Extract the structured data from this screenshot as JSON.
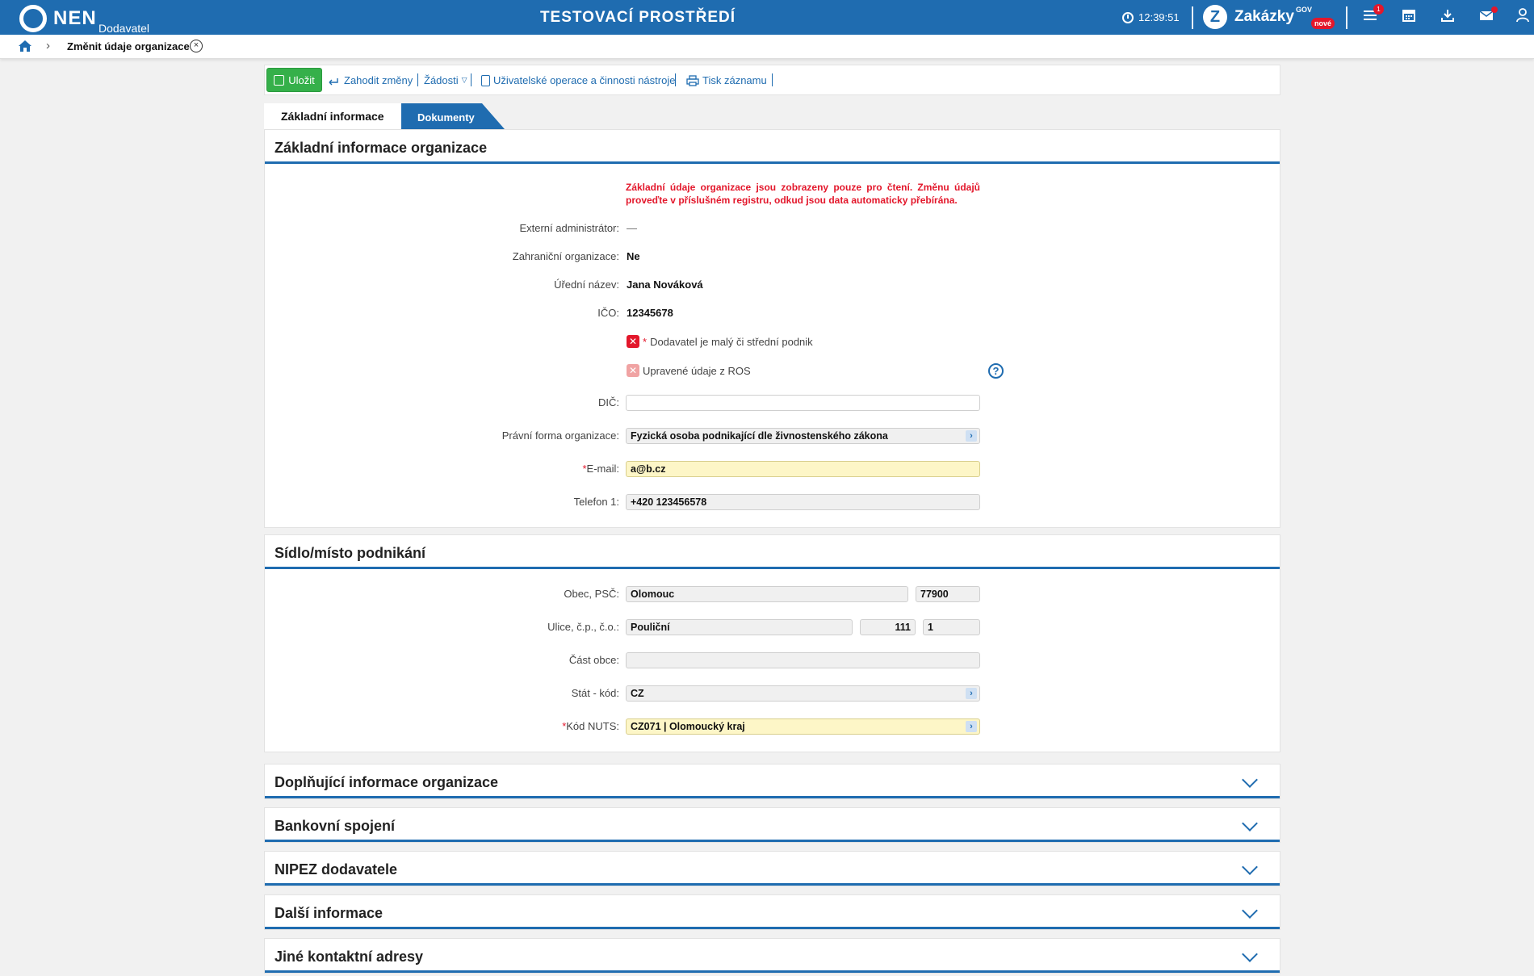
{
  "topbar": {
    "logo_text": "NEN",
    "logo_sub": "Dodavatel",
    "env_title": "TESTOVACÍ PROSTŘEDÍ",
    "time": "12:39:51",
    "zakazky": "Zakázky",
    "gov": "GOV",
    "new_badge": "nové",
    "menu_badge": "1",
    "icons": [
      "clock-icon",
      "menu-icon",
      "calendar-icon",
      "download-icon",
      "mail-icon",
      "user-icon"
    ]
  },
  "breadcrumb": {
    "label": "Změnit údaje organizace"
  },
  "toolbar": {
    "save": "Uložit",
    "discard": "Zahodit změny",
    "requests": "Žádosti",
    "user_ops": "Uživatelské operace a činnosti nástroje",
    "print": "Tisk záznamu"
  },
  "tabs": {
    "basic": "Základní informace",
    "documents": "Dokumenty"
  },
  "basic_panel": {
    "title": "Základní informace organizace",
    "notice": "Základní údaje organizace jsou zobrazeny pouze pro čtení. Změnu údajů proveďte v příslušném registru, odkud jsou data automaticky přebírána.",
    "ext_admin_label": "Externí administrátor:",
    "ext_admin_value": "—",
    "foreign_label": "Zahraniční organizace:",
    "foreign_value": "Ne",
    "official_name_label": "Úřední název:",
    "official_name_value": "Jana Nováková",
    "ico_label": "IČO:",
    "ico_value": "12345678",
    "sme_required": "*",
    "sme_label": "Dodavatel je malý či střední podnik",
    "ros_label": "Upravené údaje z ROS",
    "dic_label": "DIČ:",
    "dic_value": "",
    "legal_form_label": "Právní forma organizace:",
    "legal_form_value": "Fyzická osoba podnikající dle živnostenského zákona",
    "email_required": "*",
    "email_label": "E-mail:",
    "email_value": "a@b.cz",
    "phone_label": "Telefon 1:",
    "phone_value": "+420 123456578"
  },
  "address_panel": {
    "title": "Sídlo/místo podnikání",
    "city_label": "Obec, PSČ:",
    "city_value": "Olomouc",
    "zip_value": "77900",
    "street_label": "Ulice, č.p., č.o.:",
    "street_value": "Pouliční",
    "house_no": "111",
    "orient_no": "1",
    "district_label": "Část obce:",
    "district_value": "",
    "country_label": "Stát - kód:",
    "country_value": "CZ",
    "nuts_required": "*",
    "nuts_label": "Kód NUTS:",
    "nuts_value": "CZ071 | Olomoucký kraj"
  },
  "collapsed_panels": [
    "Doplňující informace organizace",
    "Bankovní spojení",
    "NIPEZ dodavatele",
    "Další informace",
    "Jiné kontaktní adresy"
  ],
  "colors": {
    "brand": "#1f6cb0",
    "save_green": "#35b04a",
    "error_red": "#e3172b",
    "required_yellow": "#fdf6c7"
  }
}
